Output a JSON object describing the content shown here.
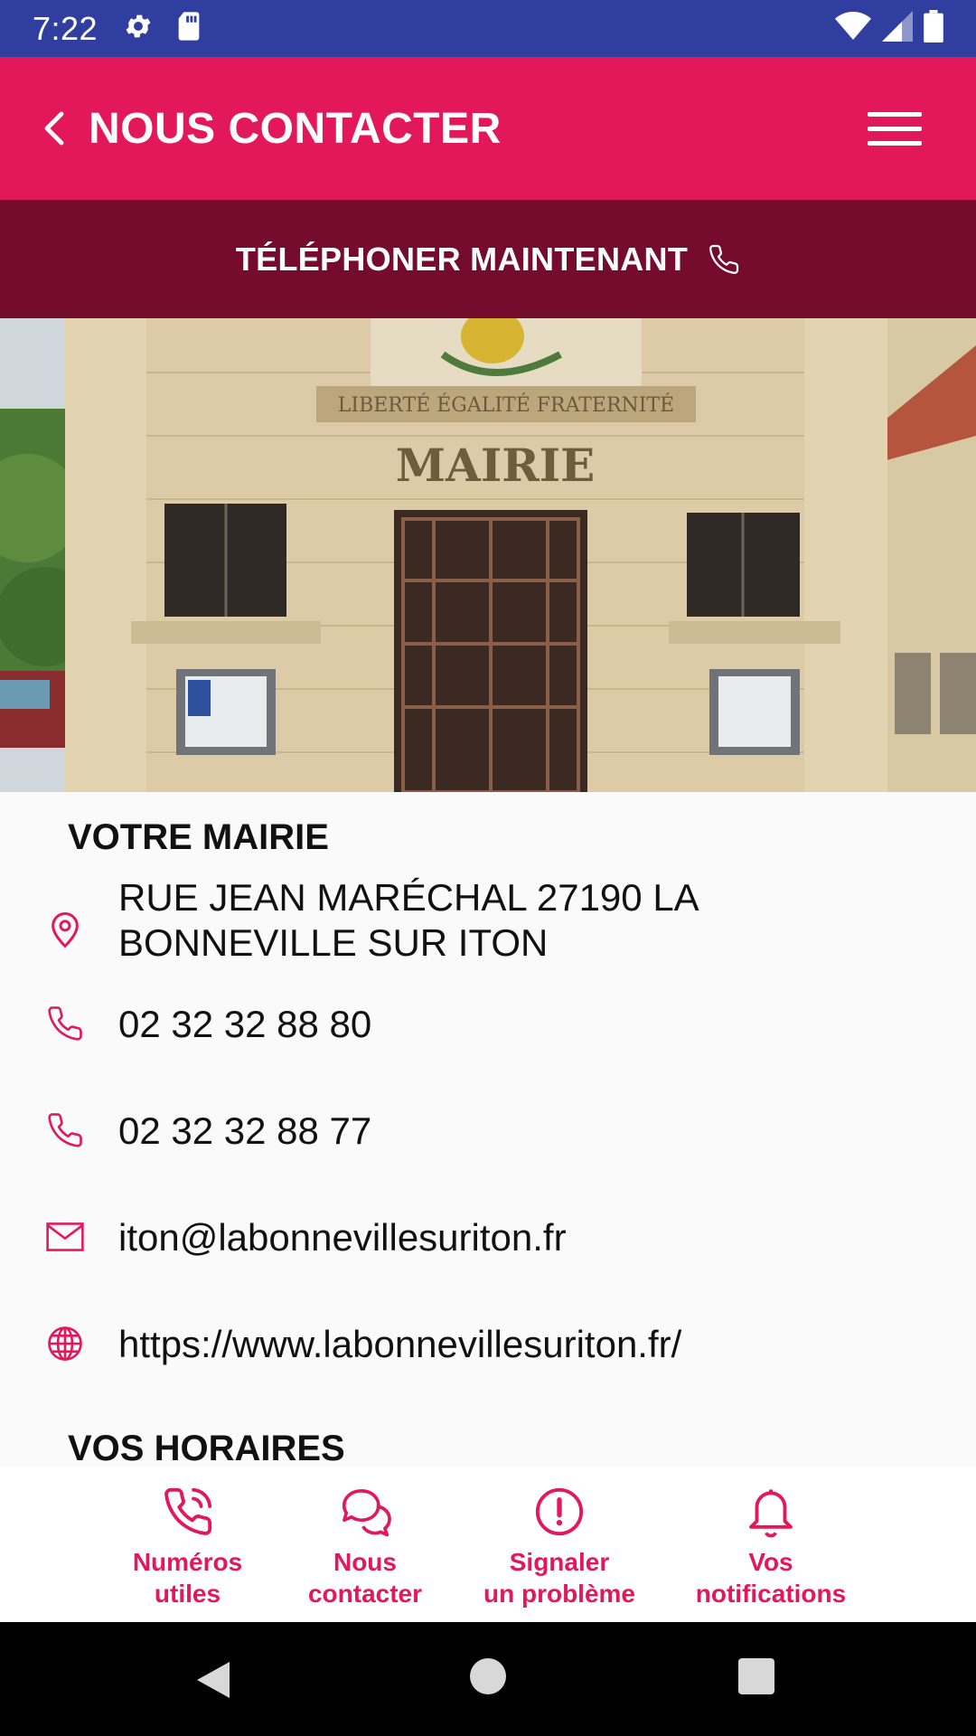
{
  "status_bar": {
    "time": "7:22"
  },
  "header": {
    "title": "NOUS CONTACTER"
  },
  "call_bar": {
    "label": "TÉLÉPHONER MAINTENANT"
  },
  "photo": {
    "sign_text": "MAIRIE",
    "motto": "LIBERTÉ ÉGALITÉ FRATERNITÉ"
  },
  "mairie": {
    "section_title": "VOTRE MAIRIE",
    "address": "RUE JEAN MARÉCHAL 27190 LA BONNEVILLE SUR ITON",
    "phone1": "02 32 32 88 80",
    "phone2": "02 32 32 88 77",
    "email": "iton@labonnevillesuriton.fr",
    "website": "https://www.labonnevillesuriton.fr/"
  },
  "hours": {
    "section_title": "VOS HORAIRES"
  },
  "bottom_nav": {
    "items": [
      {
        "label_line1": "Numéros",
        "label_line2": "utiles",
        "icon": "phone-call-icon"
      },
      {
        "label_line1": "Nous",
        "label_line2": "contacter",
        "icon": "chat-bubbles-icon"
      },
      {
        "label_line1": "Signaler",
        "label_line2": "un problème",
        "icon": "alert-circle-icon"
      },
      {
        "label_line1": "Vos",
        "label_line2": "notifications",
        "icon": "bell-icon"
      }
    ]
  },
  "colors": {
    "accent": "#e3185b",
    "call_bar": "#760c2d",
    "status_bar": "#303f9f"
  }
}
